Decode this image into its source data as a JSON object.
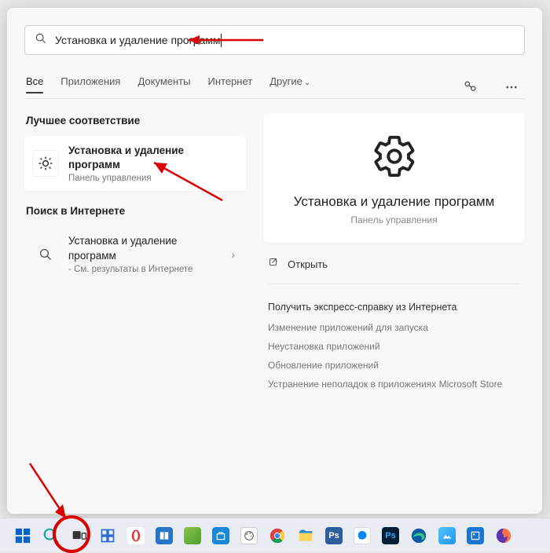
{
  "search": {
    "value": "Установка и удаление программ"
  },
  "tabs": {
    "all": "Все",
    "apps": "Приложения",
    "docs": "Документы",
    "internet": "Интернет",
    "more": "Другие"
  },
  "left": {
    "best_match": "Лучшее соответствие",
    "result1_title": "Установка и удаление программ",
    "result1_sub": "Панель управления",
    "web_header": "Поиск в Интернете",
    "result2_title": "Установка и удаление программ",
    "result2_sub": "- См. результаты в Интернете"
  },
  "detail": {
    "title": "Установка и удаление программ",
    "sub": "Панель управления",
    "open": "Открыть",
    "help_header": "Получить экспресс-справку из Интернета",
    "help1": "Изменение приложений для запуска",
    "help2": "Неустановка приложений",
    "help3": "Обновление приложений",
    "help4": "Устранение неполадок в приложениях Microsoft Store"
  }
}
